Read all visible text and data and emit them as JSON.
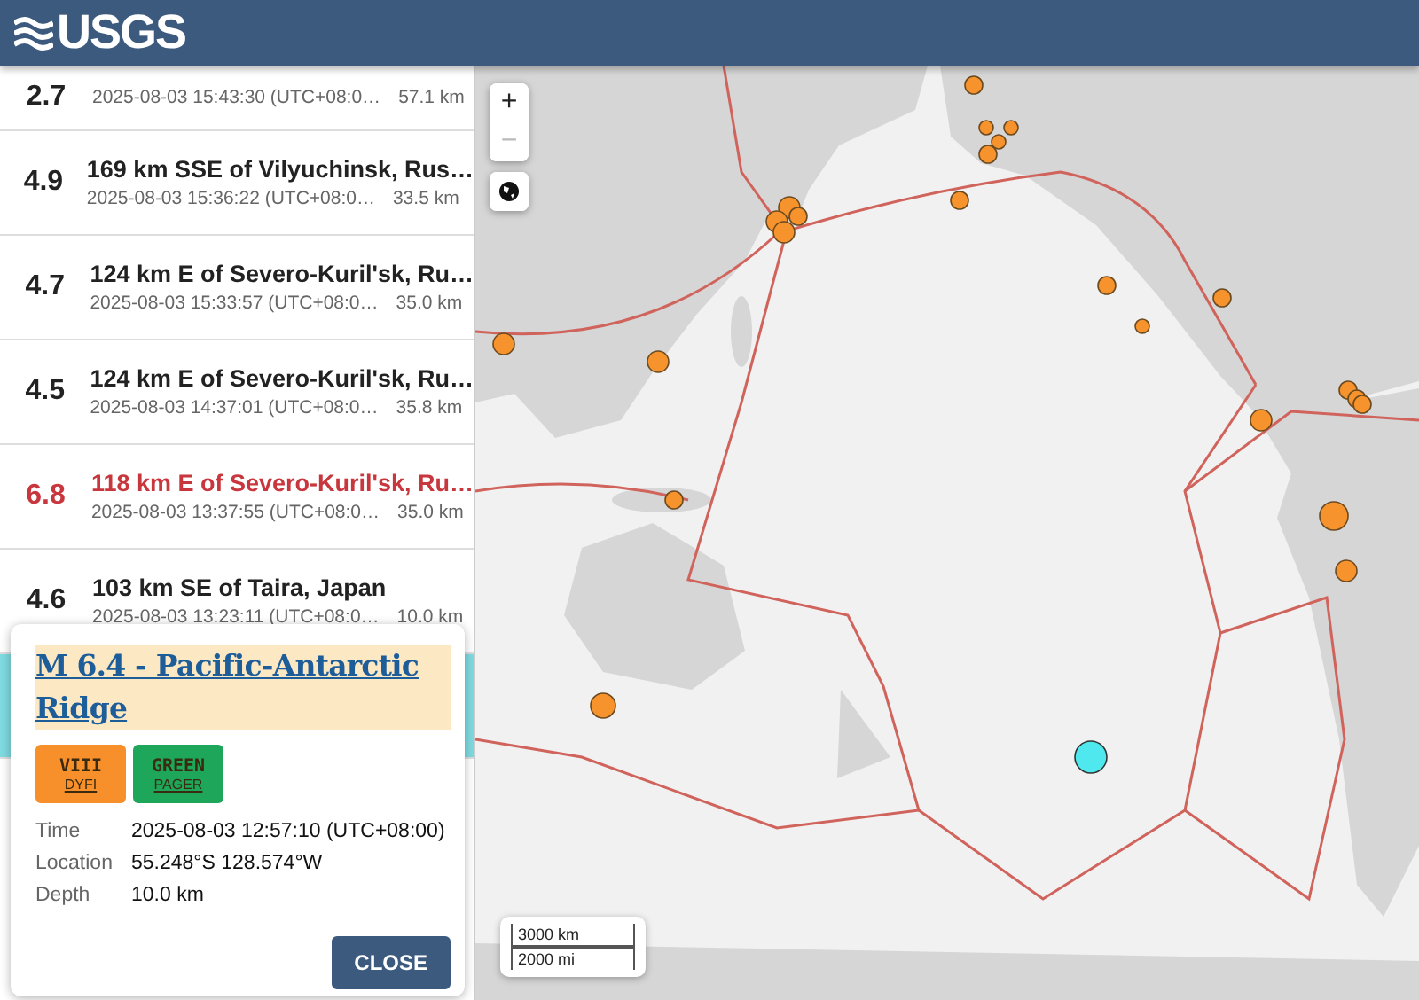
{
  "header": {
    "logo": "USGS"
  },
  "events": [
    {
      "magnitude": "2.7",
      "time": "2025-08-03 15:43:30 (UTC+08:0…",
      "depth": "57.1 km",
      "color": "#222222",
      "selected": false
    },
    {
      "magnitude": "4.9",
      "title": "169 km SSE of Vilyuchinsk, Rus…",
      "time": "2025-08-03 15:36:22 (UTC+08:0…",
      "depth": "33.5 km",
      "color": "#222222",
      "selected": false
    },
    {
      "magnitude": "4.7",
      "title": "124 km E of Severo-Kuril'sk, Ru…",
      "time": "2025-08-03 15:33:57 (UTC+08:0…",
      "depth": "35.0 km",
      "color": "#222222",
      "selected": false
    },
    {
      "magnitude": "4.5",
      "title": "124 km E of Severo-Kuril'sk, Ru…",
      "time": "2025-08-03 14:37:01 (UTC+08:0…",
      "depth": "35.8 km",
      "color": "#222222",
      "selected": false
    },
    {
      "magnitude": "6.8",
      "title": "118 km E of Severo-Kuril'sk, Ru…",
      "time": "2025-08-03 13:37:55 (UTC+08:0…",
      "depth": "35.0 km",
      "color": "#c8373d",
      "selected": false
    },
    {
      "magnitude": "4.6",
      "title": "103 km SE of Taira, Japan",
      "time": "2025-08-03 13:23:11 (UTC+08:0…",
      "depth": "10.0 km",
      "color": "#222222",
      "selected": false
    },
    {
      "selected": true
    }
  ],
  "popup": {
    "title": "M 6.4 - Pacific-Antarctic Ridge",
    "badges": [
      {
        "value": "VIII",
        "label": "DYFI",
        "color": "#f7902a"
      },
      {
        "value": "GREEN",
        "label": "PAGER",
        "color": "#1ea65a"
      }
    ],
    "details": [
      {
        "label": "Time",
        "value": "2025-08-03 12:57:10 (UTC+08:00)"
      },
      {
        "label": "Location",
        "value": "55.248°S 128.574°W"
      },
      {
        "label": "Depth",
        "value": "10.0 km"
      }
    ],
    "close": "CLOSE"
  },
  "map": {
    "zoom_in": {
      "label": "+",
      "disabled": false
    },
    "zoom_out": {
      "label": "−",
      "disabled": true
    },
    "scale": [
      "3000 km",
      "2000 mi"
    ]
  }
}
